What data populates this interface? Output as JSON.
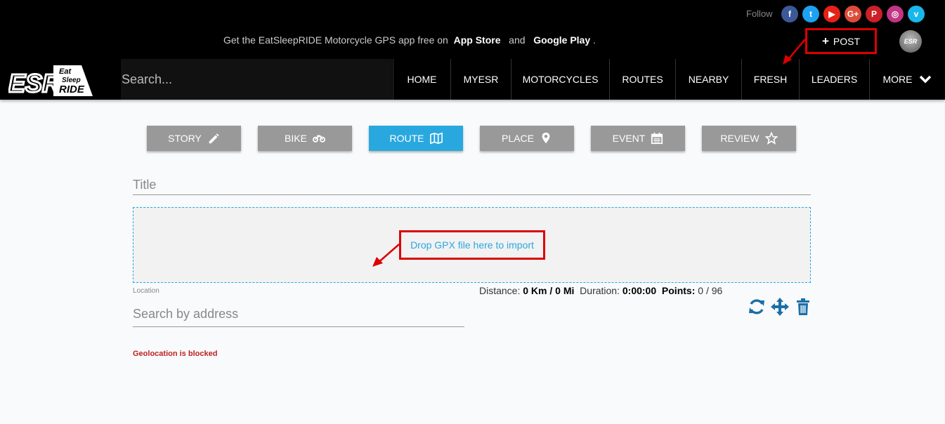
{
  "header": {
    "follow_label": "Follow",
    "social": [
      {
        "name": "facebook-icon",
        "color": "#3b5998",
        "glyph": "f"
      },
      {
        "name": "twitter-icon",
        "color": "#1da1f2",
        "glyph": "t"
      },
      {
        "name": "youtube-icon",
        "color": "#e62117",
        "glyph": "▶"
      },
      {
        "name": "google-plus-icon",
        "color": "#dd4b39",
        "glyph": "G+"
      },
      {
        "name": "pinterest-icon",
        "color": "#cb2027",
        "glyph": "P"
      },
      {
        "name": "instagram-icon",
        "color": "#c13584",
        "glyph": "◎"
      },
      {
        "name": "vimeo-icon",
        "color": "#1ab7ea",
        "glyph": "v"
      }
    ],
    "promo_prefix": "Get the EatSleepRIDE Motorcycle GPS app free on",
    "promo_store1": "App Store",
    "promo_and": "and",
    "promo_store2": "Google Play",
    "promo_suffix": ".",
    "post_label": "POST",
    "avatar_text": "ESR"
  },
  "nav": {
    "logo_main": "ESR",
    "logo_eat": "Eat",
    "logo_sleep": "Sleep",
    "logo_ride": "RIDE",
    "search_placeholder": "Search...",
    "items": [
      "HOME",
      "MYESR",
      "MOTORCYCLES",
      "ROUTES",
      "NEARBY",
      "FRESH",
      "LEADERS",
      "MORE"
    ]
  },
  "post_types": [
    {
      "label": "STORY",
      "icon": "pencil-icon"
    },
    {
      "label": "BIKE",
      "icon": "motorcycle-icon"
    },
    {
      "label": "ROUTE",
      "icon": "map-icon",
      "active": true
    },
    {
      "label": "PLACE",
      "icon": "map-marker-icon"
    },
    {
      "label": "EVENT",
      "icon": "calendar-icon"
    },
    {
      "label": "REVIEW",
      "icon": "star-icon"
    }
  ],
  "form": {
    "title_placeholder": "Title",
    "drop_text": "Drop GPX file here to import",
    "location_label": "Location",
    "location_placeholder": "Search by address",
    "stats": {
      "distance_label": "Distance:",
      "distance_value": "0 Km / 0 Mi",
      "duration_label": "Duration:",
      "duration_value": "0:00:00",
      "points_label": "Points:",
      "points_value": "0",
      "points_max": "/ 96"
    },
    "geo_message": "Geolocation is blocked"
  },
  "colors": {
    "accent": "#29a8e0",
    "highlight": "#dd0000",
    "tool_icon": "#1a6fa8",
    "error": "#bb2222"
  }
}
